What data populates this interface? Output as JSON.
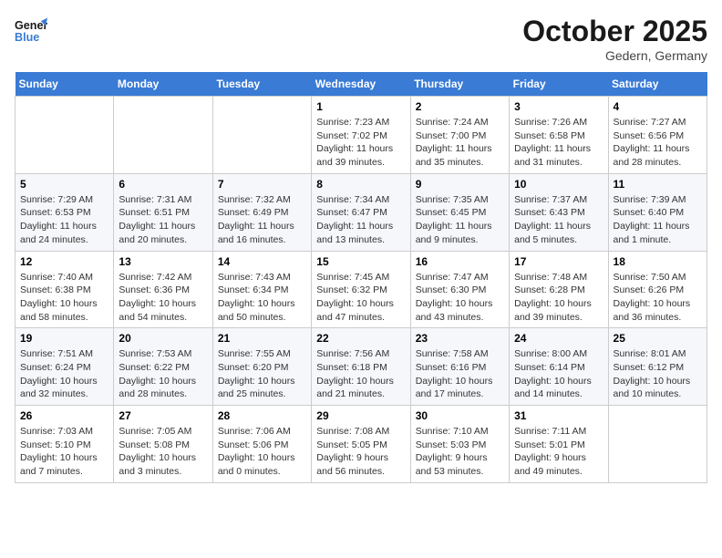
{
  "header": {
    "logo_line1": "General",
    "logo_line2": "Blue",
    "month": "October 2025",
    "location": "Gedern, Germany"
  },
  "weekdays": [
    "Sunday",
    "Monday",
    "Tuesday",
    "Wednesday",
    "Thursday",
    "Friday",
    "Saturday"
  ],
  "weeks": [
    [
      {
        "day": "",
        "info": ""
      },
      {
        "day": "",
        "info": ""
      },
      {
        "day": "",
        "info": ""
      },
      {
        "day": "1",
        "info": "Sunrise: 7:23 AM\nSunset: 7:02 PM\nDaylight: 11 hours\nand 39 minutes."
      },
      {
        "day": "2",
        "info": "Sunrise: 7:24 AM\nSunset: 7:00 PM\nDaylight: 11 hours\nand 35 minutes."
      },
      {
        "day": "3",
        "info": "Sunrise: 7:26 AM\nSunset: 6:58 PM\nDaylight: 11 hours\nand 31 minutes."
      },
      {
        "day": "4",
        "info": "Sunrise: 7:27 AM\nSunset: 6:56 PM\nDaylight: 11 hours\nand 28 minutes."
      }
    ],
    [
      {
        "day": "5",
        "info": "Sunrise: 7:29 AM\nSunset: 6:53 PM\nDaylight: 11 hours\nand 24 minutes."
      },
      {
        "day": "6",
        "info": "Sunrise: 7:31 AM\nSunset: 6:51 PM\nDaylight: 11 hours\nand 20 minutes."
      },
      {
        "day": "7",
        "info": "Sunrise: 7:32 AM\nSunset: 6:49 PM\nDaylight: 11 hours\nand 16 minutes."
      },
      {
        "day": "8",
        "info": "Sunrise: 7:34 AM\nSunset: 6:47 PM\nDaylight: 11 hours\nand 13 minutes."
      },
      {
        "day": "9",
        "info": "Sunrise: 7:35 AM\nSunset: 6:45 PM\nDaylight: 11 hours\nand 9 minutes."
      },
      {
        "day": "10",
        "info": "Sunrise: 7:37 AM\nSunset: 6:43 PM\nDaylight: 11 hours\nand 5 minutes."
      },
      {
        "day": "11",
        "info": "Sunrise: 7:39 AM\nSunset: 6:40 PM\nDaylight: 11 hours\nand 1 minute."
      }
    ],
    [
      {
        "day": "12",
        "info": "Sunrise: 7:40 AM\nSunset: 6:38 PM\nDaylight: 10 hours\nand 58 minutes."
      },
      {
        "day": "13",
        "info": "Sunrise: 7:42 AM\nSunset: 6:36 PM\nDaylight: 10 hours\nand 54 minutes."
      },
      {
        "day": "14",
        "info": "Sunrise: 7:43 AM\nSunset: 6:34 PM\nDaylight: 10 hours\nand 50 minutes."
      },
      {
        "day": "15",
        "info": "Sunrise: 7:45 AM\nSunset: 6:32 PM\nDaylight: 10 hours\nand 47 minutes."
      },
      {
        "day": "16",
        "info": "Sunrise: 7:47 AM\nSunset: 6:30 PM\nDaylight: 10 hours\nand 43 minutes."
      },
      {
        "day": "17",
        "info": "Sunrise: 7:48 AM\nSunset: 6:28 PM\nDaylight: 10 hours\nand 39 minutes."
      },
      {
        "day": "18",
        "info": "Sunrise: 7:50 AM\nSunset: 6:26 PM\nDaylight: 10 hours\nand 36 minutes."
      }
    ],
    [
      {
        "day": "19",
        "info": "Sunrise: 7:51 AM\nSunset: 6:24 PM\nDaylight: 10 hours\nand 32 minutes."
      },
      {
        "day": "20",
        "info": "Sunrise: 7:53 AM\nSunset: 6:22 PM\nDaylight: 10 hours\nand 28 minutes."
      },
      {
        "day": "21",
        "info": "Sunrise: 7:55 AM\nSunset: 6:20 PM\nDaylight: 10 hours\nand 25 minutes."
      },
      {
        "day": "22",
        "info": "Sunrise: 7:56 AM\nSunset: 6:18 PM\nDaylight: 10 hours\nand 21 minutes."
      },
      {
        "day": "23",
        "info": "Sunrise: 7:58 AM\nSunset: 6:16 PM\nDaylight: 10 hours\nand 17 minutes."
      },
      {
        "day": "24",
        "info": "Sunrise: 8:00 AM\nSunset: 6:14 PM\nDaylight: 10 hours\nand 14 minutes."
      },
      {
        "day": "25",
        "info": "Sunrise: 8:01 AM\nSunset: 6:12 PM\nDaylight: 10 hours\nand 10 minutes."
      }
    ],
    [
      {
        "day": "26",
        "info": "Sunrise: 7:03 AM\nSunset: 5:10 PM\nDaylight: 10 hours\nand 7 minutes."
      },
      {
        "day": "27",
        "info": "Sunrise: 7:05 AM\nSunset: 5:08 PM\nDaylight: 10 hours\nand 3 minutes."
      },
      {
        "day": "28",
        "info": "Sunrise: 7:06 AM\nSunset: 5:06 PM\nDaylight: 10 hours\nand 0 minutes."
      },
      {
        "day": "29",
        "info": "Sunrise: 7:08 AM\nSunset: 5:05 PM\nDaylight: 9 hours\nand 56 minutes."
      },
      {
        "day": "30",
        "info": "Sunrise: 7:10 AM\nSunset: 5:03 PM\nDaylight: 9 hours\nand 53 minutes."
      },
      {
        "day": "31",
        "info": "Sunrise: 7:11 AM\nSunset: 5:01 PM\nDaylight: 9 hours\nand 49 minutes."
      },
      {
        "day": "",
        "info": ""
      }
    ]
  ]
}
